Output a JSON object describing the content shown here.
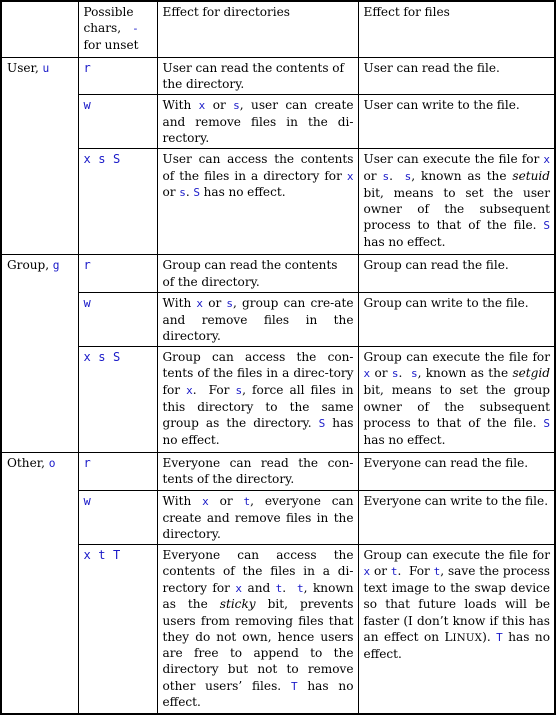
{
  "header": {
    "blank": "",
    "chars_line1": "Possible",
    "chars_line2": "chars,",
    "chars_dash": "-",
    "chars_line3": "for unset",
    "dir_label": "Effect for directories",
    "file_label": "Effect for files"
  },
  "colors": {
    "code_blue": "#1a1aC8",
    "text_black": "#000000",
    "border": "#000000",
    "background": "#ffffff"
  },
  "sections": [
    {
      "who_word": "User,",
      "who_code": "u",
      "rows": [
        {
          "chars": "r",
          "dir_text": "User can read the contents of the directory.",
          "file_text": "User can read the file."
        },
        {
          "chars": "w",
          "dir_text": "With x or s, user can create and remove files in the di-rectory.",
          "file_text": "User can write to the file."
        },
        {
          "chars": "x s S",
          "dir_text": "User can access the contents of the files in a directory for x or s. S has no effect.",
          "file_text": "User can execute the file for x or s. s, known as the setuid bit, means to set the user owner of the subsequent process to that of the file. S has no effect."
        }
      ]
    },
    {
      "who_word": "Group,",
      "who_code": "g",
      "rows": [
        {
          "chars": "r",
          "dir_text": "Group can read the contents of the directory.",
          "file_text": "Group can read the file."
        },
        {
          "chars": "w",
          "dir_text": "With x or s, group can create and remove files in the directory.",
          "file_text": "Group can write to the file."
        },
        {
          "chars": "x s S",
          "dir_text": "Group can access the contents of the files in a directory for x. For s, force all files in this directory to the same group as the directory. S has no effect.",
          "file_text": "Group can execute the file for x or s. s, known as the setgid bit, means to set the group owner of the subsequent process to that of the file. S has no effect."
        }
      ]
    },
    {
      "who_word": "Other,",
      "who_code": "o",
      "rows": [
        {
          "chars": "r",
          "dir_text": "Everyone can read the contents of the directory.",
          "file_text": "Everyone can read the file."
        },
        {
          "chars": "w",
          "dir_text": "With x or t, everyone can create and remove files in the directory.",
          "file_text": "Everyone can write to the file."
        },
        {
          "chars": "x t T",
          "dir_text": "Everyone can access the contents of the files in a directory for x and t. t, known as the sticky bit, prevents users from removing files that they do not own, hence users are free to append to the directory but not to remove other users' files. T has no effect.",
          "file_text": "Group can execute the file for x or t. For t, save the process text image to the swap device so that future loads will be faster (I don't know if this has an effect on LINUX). T has no effect."
        }
      ]
    }
  ]
}
